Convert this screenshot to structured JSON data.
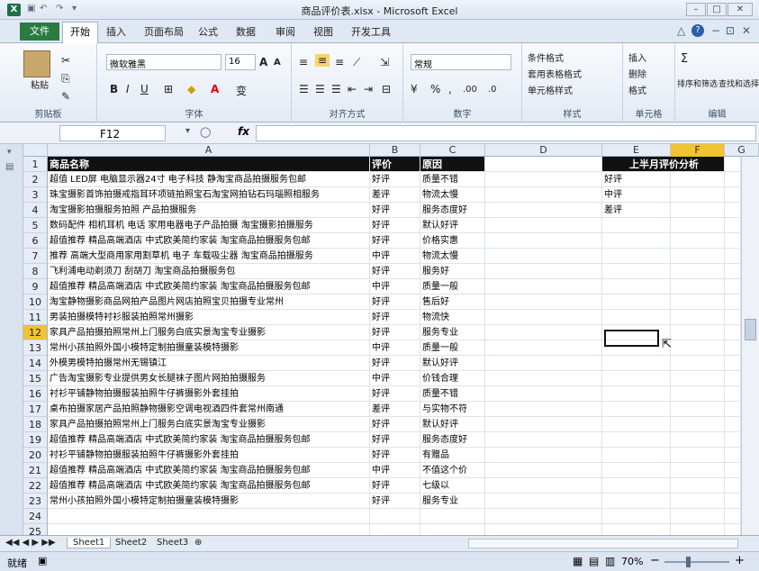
{
  "window": {
    "title": "商品评价表.xlsx - Microsoft Excel",
    "app_icon": "X",
    "min": "–",
    "max": "□",
    "close": "✕"
  },
  "tabs": {
    "file": "文件",
    "home": "开始",
    "others": [
      "插入",
      "页面布局",
      "公式",
      "数据",
      "审阅",
      "视图",
      "开发工具"
    ],
    "right_icons": [
      "△",
      "?",
      "−",
      "⊡",
      "✕"
    ]
  },
  "ribbon": {
    "clipboard": {
      "label": "剪贴板",
      "paste": "粘贴"
    },
    "font": {
      "label": "字体",
      "name": "微软雅黑",
      "size": "16",
      "bold": "B",
      "italic": "I",
      "underline": "U",
      "grow": "A",
      "shrink": "A",
      "phonetic": "变"
    },
    "align": {
      "label": "对齐方式"
    },
    "number": {
      "label": "数字",
      "format": "常规",
      "pct": "%",
      "comma": ",",
      "inc": ".00",
      "dec": ".0"
    },
    "styles": {
      "label": "样式",
      "cond": "条件格式",
      "table": "套用表格格式",
      "cell": "单元格样式"
    },
    "cells": {
      "label": "单元格",
      "insert": "插入",
      "delete": "删除",
      "format": "格式"
    },
    "edit": {
      "label": "编辑",
      "sum": "Σ",
      "sort": "排序和筛选",
      "find": "查找和选择"
    }
  },
  "formula": {
    "namebox": "F12",
    "fx": "fx",
    "value": ""
  },
  "columns": [
    {
      "label": "A"
    },
    {
      "label": "B"
    },
    {
      "label": "C"
    },
    {
      "label": "D"
    },
    {
      "label": "E"
    },
    {
      "label": "F"
    },
    {
      "label": "G"
    }
  ],
  "rows": [
    {
      "n": "1",
      "a": "商品名称",
      "b": "评价",
      "c": "原因",
      "e": "上半月评价分析"
    },
    {
      "n": "2",
      "a": "超值 LED屏 电脑显示器24寸 电子科技 静淘宝商品拍摄服务包邮",
      "b": "好评",
      "c": "质量不错",
      "e": "好评"
    },
    {
      "n": "3",
      "a": "珠宝摄影首饰拍摄戒指耳环项链拍照宝石淘宝网拍钻石玛瑙照相服务",
      "b": "差评",
      "c": "物流太慢",
      "e": "中评"
    },
    {
      "n": "4",
      "a": "淘宝摄影拍摄服务拍照 产品拍摄服务",
      "b": "好评",
      "c": "服务态度好",
      "e": "差评"
    },
    {
      "n": "5",
      "a": "数码配件 相机耳机 电话 家用电器电子产品拍摄 淘宝摄影拍摄服务",
      "b": "好评",
      "c": "默认好评"
    },
    {
      "n": "6",
      "a": "超值推荐 精品高端酒店 中式欧美简约家装 淘宝商品拍摄服务包邮",
      "b": "好评",
      "c": "价格实惠"
    },
    {
      "n": "7",
      "a": "推荐 高端大型商用家用割草机 电子 车载吸尘器 淘宝商品拍摄服务",
      "b": "中评",
      "c": "物流太慢"
    },
    {
      "n": "8",
      "a": "飞利浦电动剃须刀 刮胡刀 淘宝商品拍摄服务包",
      "b": "好评",
      "c": "服务好"
    },
    {
      "n": "9",
      "a": "超值推荐 精品高端酒店 中式欧美简约家装 淘宝商品拍摄服务包邮",
      "b": "中评",
      "c": "质量一般"
    },
    {
      "n": "10",
      "a": "淘宝静物摄影商品网拍产品图片网店拍照宝贝拍摄专业常州",
      "b": "好评",
      "c": "售后好"
    },
    {
      "n": "11",
      "a": "男装拍摄模特衬衫服装拍照常州摄影",
      "b": "好评",
      "c": "物流快"
    },
    {
      "n": "12",
      "a": "家具产品拍摄拍照常州上门服务白底实景淘宝专业摄影",
      "b": "好评",
      "c": "服务专业"
    },
    {
      "n": "13",
      "a": "常州小孩拍照外国小模特定制拍摄童装模特摄影",
      "b": "中评",
      "c": "质量一般"
    },
    {
      "n": "14",
      "a": "外模男模特拍摄常州无锡镇江",
      "b": "好评",
      "c": "默认好评"
    },
    {
      "n": "15",
      "a": "广告淘宝摄影专业提供男女长腿袜子图片网拍拍摄服务",
      "b": "中评",
      "c": "价钱合理"
    },
    {
      "n": "16",
      "a": "衬衫平铺静物拍摄服装拍照牛仔裤摄影外套挂拍",
      "b": "好评",
      "c": "质量不错"
    },
    {
      "n": "17",
      "a": "桌布拍摄家居产品拍照静物摄影空调电视酒四件套常州南通",
      "b": "差评",
      "c": "与实物不符"
    },
    {
      "n": "18",
      "a": "家具产品拍摄拍照常州上门服务白底实景淘宝专业摄影",
      "b": "好评",
      "c": "默认好评"
    },
    {
      "n": "19",
      "a": "超值推荐 精品高端酒店 中式欧美简约家装 淘宝商品拍摄服务包邮",
      "b": "好评",
      "c": "服务态度好"
    },
    {
      "n": "20",
      "a": "衬衫平铺静物拍摄服装拍照牛仔裤摄影外套挂拍",
      "b": "好评",
      "c": "有赠品"
    },
    {
      "n": "21",
      "a": "超值推荐 精品高端酒店 中式欧美简约家装 淘宝商品拍摄服务包邮",
      "b": "中评",
      "c": "不值这个价"
    },
    {
      "n": "22",
      "a": "超值推荐 精品高端酒店 中式欧美简约家装 淘宝商品拍摄服务包邮",
      "b": "好评",
      "c": "七级以"
    },
    {
      "n": "23",
      "a": "常州小孩拍照外国小模特定制拍摄童装模特摄影",
      "b": "好评",
      "c": "服务专业"
    },
    {
      "n": "24",
      "a": "",
      "b": "",
      "c": ""
    },
    {
      "n": "25",
      "a": "",
      "b": "",
      "c": ""
    }
  ],
  "sheets": {
    "nav": "◀◀ ◀ ▶ ▶▶",
    "tabs": [
      "Sheet1",
      "Sheet2",
      "Sheet3"
    ],
    "add": "⊕"
  },
  "status": {
    "ready": "就绪",
    "zoom": "70%",
    "minus": "−",
    "plus": "+"
  }
}
